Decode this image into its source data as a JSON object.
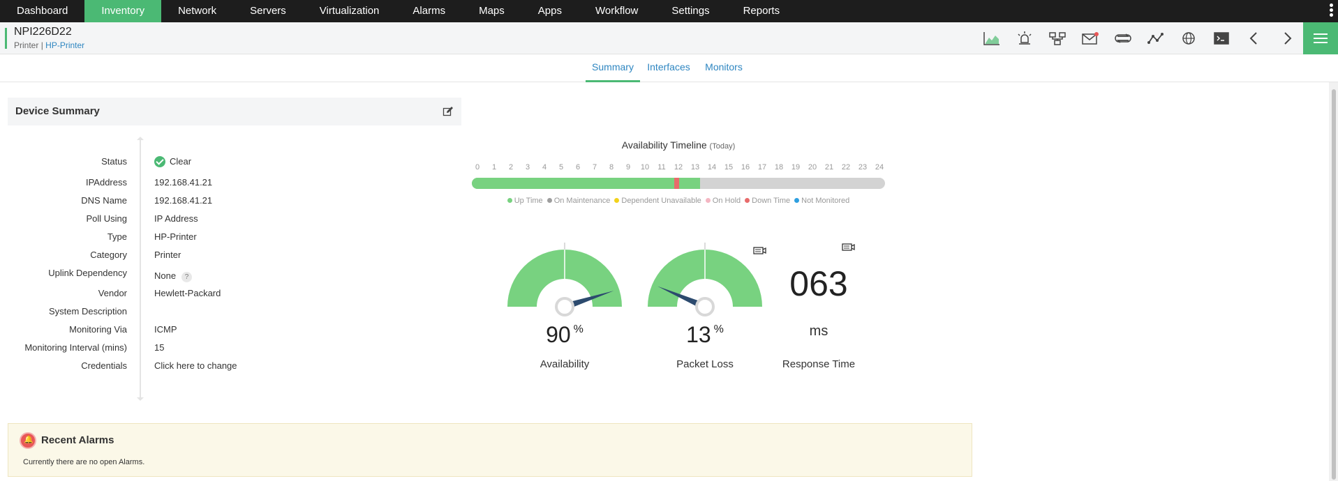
{
  "nav": {
    "items": [
      "Dashboard",
      "Inventory",
      "Network",
      "Servers",
      "Virtualization",
      "Alarms",
      "Maps",
      "Apps",
      "Workflow",
      "Settings",
      "Reports"
    ],
    "active": "Inventory"
  },
  "device": {
    "name": "NPI226D22",
    "type": "Printer",
    "separator": "|",
    "model_link": "HP-Printer"
  },
  "toolbar_icons": [
    "graph-icon",
    "alarm-icon",
    "network-topology-icon",
    "mail-icon",
    "sync-icon",
    "trend-icon",
    "globe-icon",
    "terminal-icon",
    "chevron-left-icon",
    "chevron-right-icon"
  ],
  "tabs": [
    "Summary",
    "Interfaces",
    "Monitors"
  ],
  "active_tab": "Summary",
  "summary": {
    "title": "Device Summary",
    "properties": [
      {
        "label": "Status",
        "value": "Clear"
      },
      {
        "label": "IPAddress",
        "value": "192.168.41.21"
      },
      {
        "label": "DNS Name",
        "value": "192.168.41.21"
      },
      {
        "label": "Poll Using",
        "value": "IP Address"
      },
      {
        "label": "Type",
        "value": "HP-Printer"
      },
      {
        "label": "Category",
        "value": "Printer"
      },
      {
        "label": "Uplink Dependency",
        "value": "None"
      },
      {
        "label": "Vendor",
        "value": "Hewlett-Packard"
      },
      {
        "label": "System Description",
        "value": ""
      },
      {
        "label": "Monitoring Via",
        "value": "ICMP"
      },
      {
        "label": "Monitoring Interval (mins)",
        "value": "15"
      },
      {
        "label": "Credentials",
        "value": "Click here to change"
      }
    ],
    "help_glyph": "?"
  },
  "timeline": {
    "title": "Availability Timeline",
    "period": "(Today)",
    "hours": [
      "0",
      "1",
      "2",
      "3",
      "4",
      "5",
      "6",
      "7",
      "8",
      "9",
      "10",
      "11",
      "12",
      "13",
      "14",
      "15",
      "16",
      "17",
      "18",
      "19",
      "20",
      "21",
      "22",
      "23",
      "24"
    ],
    "up_until_hour": 13.25,
    "down_from_hour": 11.75,
    "down_to_hour": 12.05,
    "legend": [
      {
        "label": "Up Time",
        "color": "#78d280"
      },
      {
        "label": "On Maintenance",
        "color": "#9e9e9e"
      },
      {
        "label": "Dependent Unavailable",
        "color": "#f2d21b"
      },
      {
        "label": "On Hold",
        "color": "#f4b6c2"
      },
      {
        "label": "Down Time",
        "color": "#e86b6b"
      },
      {
        "label": "Not Monitored",
        "color": "#2e9fe0"
      }
    ]
  },
  "gauges": {
    "availability": {
      "value": "90",
      "unit": "%",
      "label": "Availability",
      "fraction": 0.9
    },
    "packet_loss": {
      "value": "13",
      "unit": "%",
      "label": "Packet Loss",
      "fraction": 0.13
    },
    "response_time": {
      "value": "063",
      "unit": "ms",
      "label": "Response Time"
    }
  },
  "alarms": {
    "title": "Recent Alarms",
    "message": "Currently there are no open Alarms."
  },
  "colors": {
    "accent": "#4bb974",
    "link": "#2e86c1",
    "gauge_fill": "#78d280",
    "needle": "#2c4a6e"
  }
}
